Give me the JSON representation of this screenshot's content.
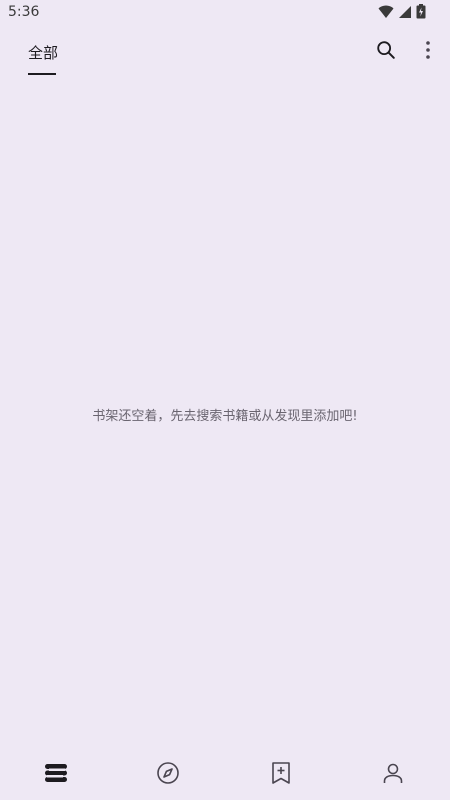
{
  "status_bar": {
    "time": "5:36",
    "icons": [
      "wifi-icon",
      "signal-icon",
      "battery-charging-icon"
    ]
  },
  "top_bar": {
    "tabs": [
      {
        "label": "全部",
        "selected": true
      }
    ],
    "actions": [
      "search-icon",
      "more-vert-icon"
    ]
  },
  "main": {
    "empty_message": "书架还空着，先去搜索书籍或从发现里添加吧!"
  },
  "bottom_nav": {
    "items": [
      {
        "icon": "bookshelf-icon",
        "selected": true
      },
      {
        "icon": "explore-compass-icon",
        "selected": false
      },
      {
        "icon": "bookmark-add-icon",
        "selected": false
      },
      {
        "icon": "person-icon",
        "selected": false
      }
    ]
  },
  "colors": {
    "background": "#EEE8F4",
    "text_primary": "#1d1b20",
    "text_secondary": "#6a6570",
    "icon_inactive": "#4a4550"
  }
}
